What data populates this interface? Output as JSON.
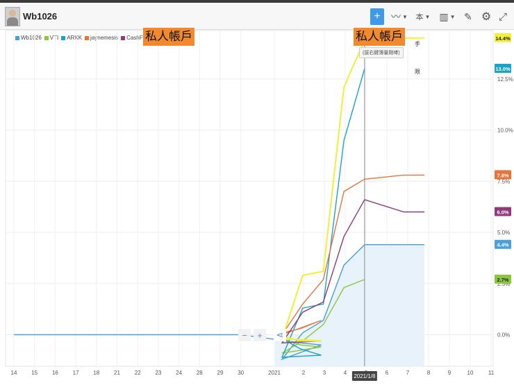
{
  "header": {
    "title": "Wb1026",
    "tools": [
      {
        "name": "crosshair-tool",
        "icon": "crosshair-icon",
        "glyph": "+"
      },
      {
        "name": "compare-tool",
        "icon": "line-chart-icon",
        "glyph": "〰"
      },
      {
        "name": "period-tool",
        "icon": "period-icon",
        "glyph": "本"
      },
      {
        "name": "candle-tool",
        "icon": "candlestick-icon",
        "glyph": "▥"
      },
      {
        "name": "draw-tool",
        "icon": "pencil-icon",
        "glyph": "✎"
      },
      {
        "name": "settings-tool",
        "icon": "gear-icon",
        "glyph": "⚙"
      },
      {
        "name": "fullscreen-tool",
        "icon": "expand-icon",
        "glyph": "⤢"
      }
    ]
  },
  "overlays": {
    "left": "私人帳戶",
    "right": "私人帳戶"
  },
  "tooltip": "(拔右鍵簿量剛哮)",
  "side_chars": [
    "手",
    "限"
  ],
  "colors": {
    "accent": "#3d9be9",
    "overlay": "#f18a2e"
  },
  "chart_data": {
    "type": "line",
    "x": [
      "2020-12-14",
      "2020-12-15",
      "2020-12-16",
      "2020-12-17",
      "2020-12-18",
      "2020-12-21",
      "2020-12-22",
      "2020-12-23",
      "2020-12-24",
      "2020-12-28",
      "2020-12-29",
      "2020-12-30",
      "2020-12-31",
      "2021-01-04",
      "2021-01-05",
      "2021-01-06",
      "2021-01-07",
      "2021-01-08",
      "2021-01-11"
    ],
    "x_tick_labels": [
      "14",
      "15",
      "16",
      "17",
      "18",
      "21",
      "22",
      "23",
      "24",
      "28",
      "29",
      "30",
      "2021",
      "2",
      "3",
      "4",
      "5",
      "6",
      "7",
      "8",
      "9",
      "10",
      "11"
    ],
    "crosshair_label": "2021/1/8",
    "y_ticks": [
      "12.5%",
      "10.0%",
      "7.5%",
      "5.0%",
      "2.5%",
      "0.0%"
    ],
    "ylim": [
      -1.2,
      15.5
    ],
    "series": [
      {
        "name": "Wb1026",
        "color": "#4a9fd8",
        "last_label": "4.4%",
        "points": [
          [
            "2020-12-14",
            0
          ],
          [
            "2020-12-30",
            0
          ],
          [
            "2021-01-02",
            -0.4
          ],
          [
            "2021-01-03",
            -0.5
          ],
          [
            "2021-01-04",
            -1.2
          ],
          [
            "2021-01-05",
            0.1
          ],
          [
            "2021-01-06",
            0.7
          ],
          [
            "2021-01-07",
            3.4
          ],
          [
            "2021-01-08",
            4.4
          ],
          [
            "2021-01-10",
            4.4
          ]
        ]
      },
      {
        "name": "VTI",
        "color": "#8cc63f",
        "last_label": "2.7%",
        "points": [
          [
            "2021-01-01",
            -0.1
          ],
          [
            "2021-01-02",
            -0.5
          ],
          [
            "2021-01-03",
            -0.6
          ],
          [
            "2021-01-04",
            -0.9
          ],
          [
            "2021-01-05",
            -0.3
          ],
          [
            "2021-01-06",
            0.5
          ],
          [
            "2021-01-07",
            2.3
          ],
          [
            "2021-01-08",
            2.7
          ]
        ]
      },
      {
        "name": "ARKK",
        "color": "#1aa3c9",
        "last_label": "13.0%",
        "points": [
          [
            "2021-01-01",
            0
          ],
          [
            "2021-01-02",
            -0.7
          ],
          [
            "2021-01-03",
            -1.0
          ],
          [
            "2021-01-04",
            -1.1
          ],
          [
            "2021-01-05",
            1.3
          ],
          [
            "2021-01-06",
            1.5
          ],
          [
            "2021-01-07",
            9.5
          ],
          [
            "2021-01-08",
            13.0
          ]
        ]
      },
      {
        "name": "jaynemesis",
        "color": "#e8743b",
        "last_label": "7.8%",
        "points": [
          [
            "2021-01-01",
            0
          ],
          [
            "2021-01-02",
            0.3
          ],
          [
            "2021-01-03",
            0.7
          ],
          [
            "2021-01-04",
            0.0
          ],
          [
            "2021-01-05",
            1.5
          ],
          [
            "2021-01-06",
            2.7
          ],
          [
            "2021-01-07",
            7.0
          ],
          [
            "2021-01-08",
            7.6
          ],
          [
            "2021-01-09",
            7.8
          ],
          [
            "2021-01-10",
            7.8
          ]
        ]
      },
      {
        "name": "CashFlowStation",
        "color": "#8e3b7a",
        "last_label": "6.0%",
        "points": [
          [
            "2021-01-01",
            0
          ],
          [
            "2021-01-02",
            -0.3
          ],
          [
            "2021-01-03",
            -0.3
          ],
          [
            "2021-01-04",
            -0.4
          ],
          [
            "2021-01-05",
            1.1
          ],
          [
            "2021-01-06",
            1.6
          ],
          [
            "2021-01-07",
            4.8
          ],
          [
            "2021-01-08",
            6.6
          ],
          [
            "2021-01-09",
            6.0
          ],
          [
            "2021-01-10",
            6.0
          ]
        ]
      },
      {
        "name": "",
        "color": "#f2ef3a",
        "last_label": "14.4%",
        "points": [
          [
            "2021-01-01",
            0
          ],
          [
            "2021-01-02",
            -0.3
          ],
          [
            "2021-01-03",
            -0.3
          ],
          [
            "2021-01-04",
            -0.2
          ],
          [
            "2021-01-05",
            2.9
          ],
          [
            "2021-01-06",
            3.1
          ],
          [
            "2021-01-07",
            12.1
          ],
          [
            "2021-01-08",
            14.4
          ],
          [
            "2021-01-09",
            14.5
          ],
          [
            "2021-01-10",
            14.5
          ]
        ]
      }
    ]
  }
}
